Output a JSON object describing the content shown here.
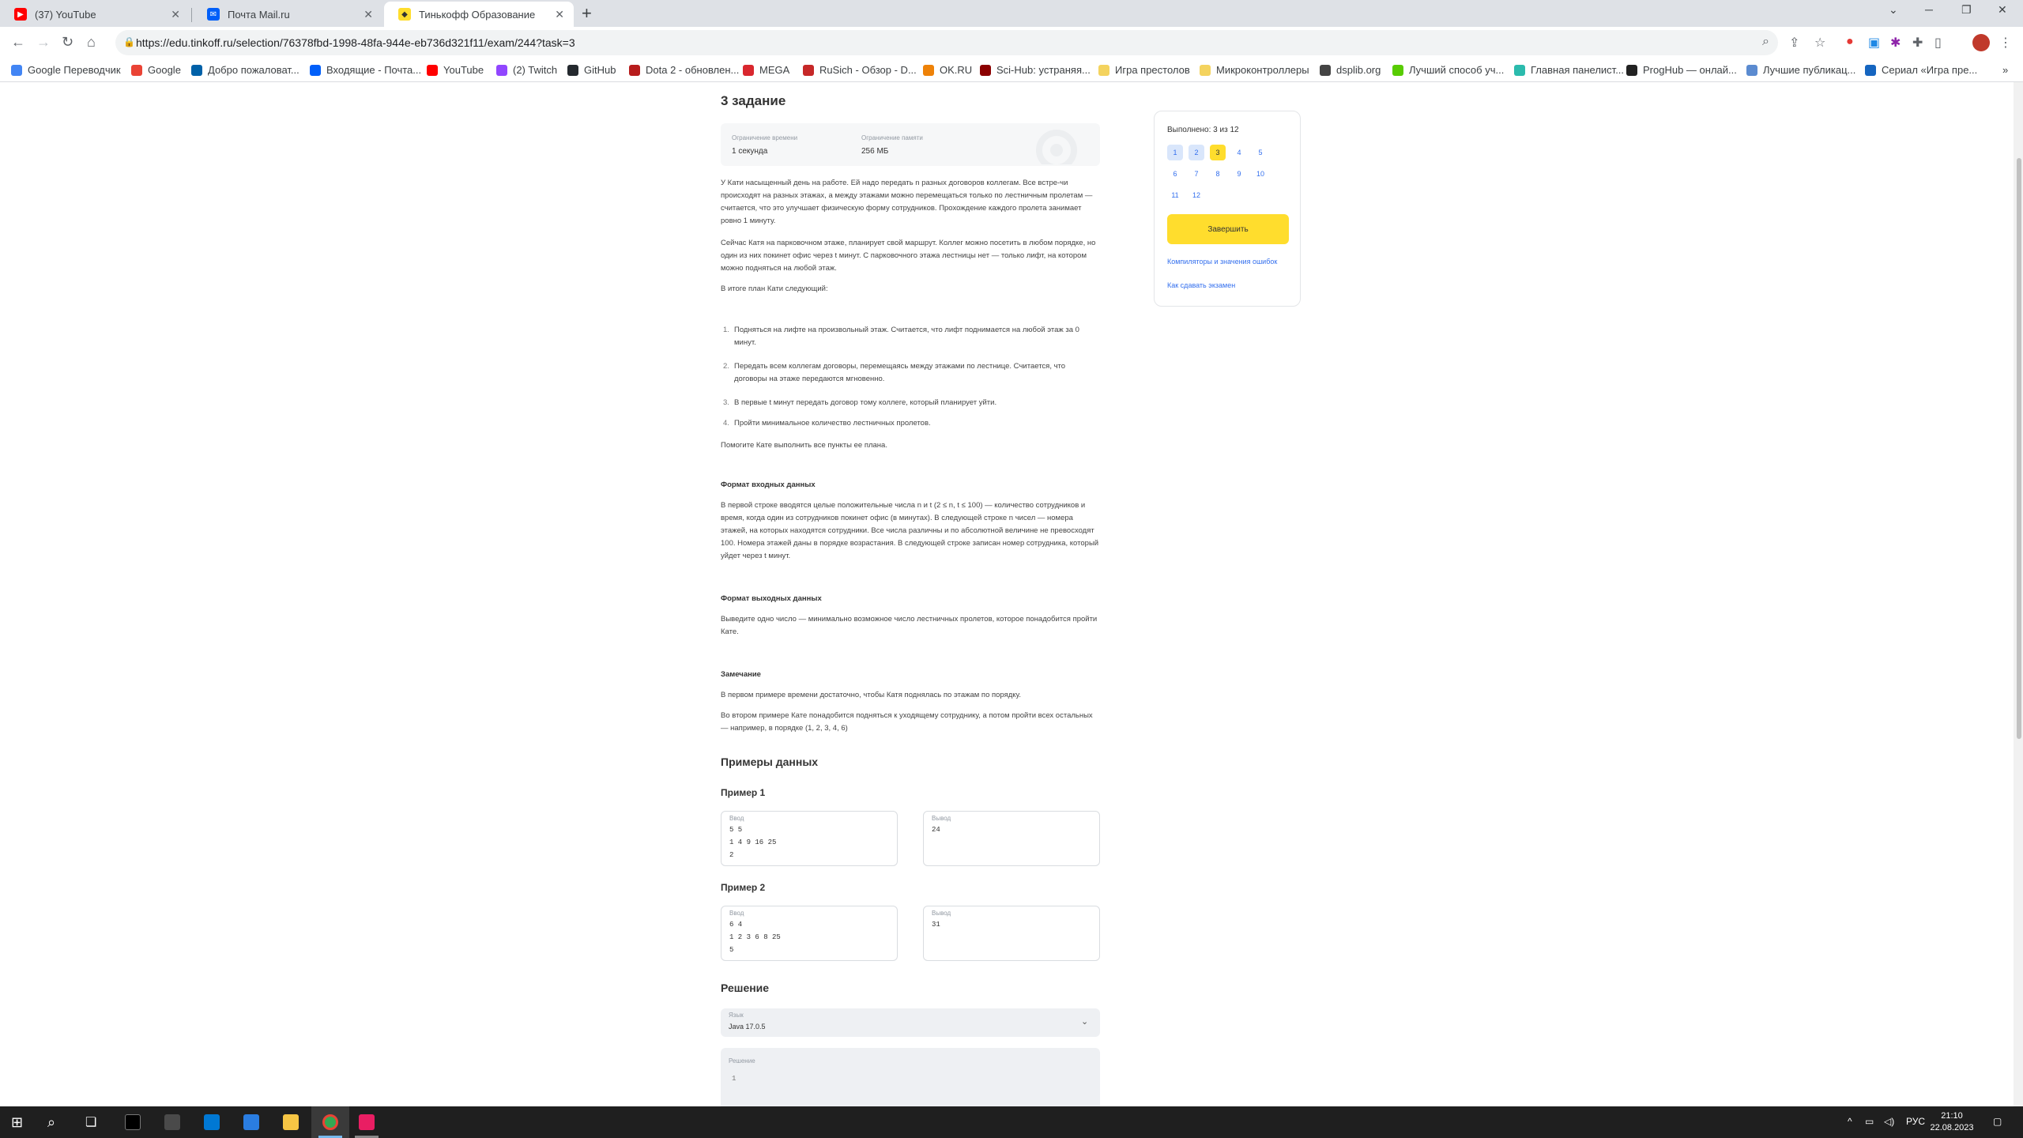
{
  "browser": {
    "tabs": [
      {
        "title": "(37) YouTube",
        "color": "#ff0000"
      },
      {
        "title": "Почта Mail.ru",
        "color": "#005ff9"
      },
      {
        "title": "Тинькофф Образование",
        "color": "#ffdd2d",
        "active": true
      }
    ],
    "url": "https://edu.tinkoff.ru/selection/76378fbd-1998-48fa-944e-eb736d321f11/exam/244?task=3",
    "bookmarks": [
      {
        "label": "Google Переводчик",
        "color": "#4285f4"
      },
      {
        "label": "Google",
        "color": "#ea4335"
      },
      {
        "label": "Добро пожаловат...",
        "color": "#0061a8"
      },
      {
        "label": "Входящие - Почта...",
        "color": "#005ff9"
      },
      {
        "label": "YouTube",
        "color": "#ff0000"
      },
      {
        "label": "(2) Twitch",
        "color": "#9146ff"
      },
      {
        "label": "GitHub",
        "color": "#24292e"
      },
      {
        "label": "Dota 2 - обновлен...",
        "color": "#b71c1c"
      },
      {
        "label": "MEGA",
        "color": "#d9272e"
      },
      {
        "label": "RuSich - Обзор - D...",
        "color": "#c62828"
      },
      {
        "label": "OK.RU",
        "color": "#ee8208"
      },
      {
        "label": "Sci-Hub: устраняя...",
        "color": "#8b0000"
      },
      {
        "label": "Игра престолов",
        "color": "#f4d35e"
      },
      {
        "label": "Микроконтроллеры",
        "color": "#f4d35e"
      },
      {
        "label": "dsplib.org",
        "color": "#444444"
      },
      {
        "label": "Лучший способ уч...",
        "color": "#58cc02"
      },
      {
        "label": "Главная панелист...",
        "color": "#2bbbad"
      },
      {
        "label": "ProgHub — онлай...",
        "color": "#222222"
      },
      {
        "label": "Лучшие публикац...",
        "color": "#5b8bd0"
      },
      {
        "label": "Сериал «Игра пре...",
        "color": "#1565c0"
      }
    ]
  },
  "task": {
    "title": "3 задание",
    "time_label": "Ограничение времени",
    "time_value": "1 секунда",
    "memory_label": "Ограничение памяти",
    "memory_value": "256 МБ",
    "statement": [
      "У Кати насыщенный день на работе. Ей надо передать n разных договоров коллегам. Все встре-чи происходят на разных этажах, а между этажами можно перемещаться только по лестничным пролетам — считается, что это улучшает физическую форму сотрудников. Прохождение каждого пролета занимает ровно 1 минуту.",
      "Сейчас Катя на парковочном этаже, планирует свой маршрут. Коллег можно посетить в любом порядке, но один из них покинет офис через t минут. С парковочного этажа лестницы нет — только лифт, на котором можно подняться на любой этаж.",
      "В итоге план Кати следующий:"
    ],
    "plan": [
      "Подняться на лифте на произвольный этаж. Считается, что лифт поднимается на любой этаж за 0 минут.",
      "Передать всем коллегам договоры, перемещаясь между этажами по лестнице. Считается, что договоры на этаже передаются мгновенно.",
      "В первые t минут передать договор тому коллеге, который планирует уйти.",
      "Пройти минимальное количество лестничных пролетов."
    ],
    "help": "Помогите Кате выполнить все пункты ее плана.",
    "input_title": "Формат входных данных",
    "input_text": "В первой строке вводятся целые положительные числа n и t (2 ≤ n, t ≤ 100) — количество сотрудников и время, когда один из сотрудников покинет офис (в минутах). В следующей строке n чисел — номера этажей, на которых находятся сотрудники. Все числа различны и по абсолютной величине не превосходят 100. Номера этажей даны в порядке возрастания. В следующей строке записан номер сотрудника, который уйдет через t минут.",
    "output_title": "Формат выходных данных",
    "output_text": "Выведите одно число — минимально возможное число лестничных пролетов, которое понадобится пройти Кате.",
    "note_title": "Замечание",
    "note_1": "В первом примере времени достаточно, чтобы Катя поднялась по этажам по порядку.",
    "note_2": "Во втором примере Кате понадобится подняться к уходящему сотруднику, а потом пройти всех остальных — например, в порядке (1, 2, 3, 4, 6)",
    "examples_title": "Примеры данных",
    "example1_title": "Пример 1",
    "example2_title": "Пример 2",
    "in_label": "Ввод",
    "out_label": "Вывод",
    "example1_in": [
      "5 5",
      "1 4 9 16 25",
      "2"
    ],
    "example1_out": "24",
    "example2_in": [
      "6 4",
      "1 2 3 6 8 25",
      "5"
    ],
    "example2_out": "31",
    "solution_title": "Решение",
    "lang_label": "Язык",
    "lang_value": "Java 17.0.5",
    "editor_label": "Решение",
    "editor_line": "1"
  },
  "panel": {
    "progress": "Выполнено: 3 из 12",
    "questions": [
      "1",
      "2",
      "3",
      "4",
      "5",
      "6",
      "7",
      "8",
      "9",
      "10",
      "11",
      "12"
    ],
    "finish": "Завершить",
    "link1": "Компиляторы и значения ошибок",
    "link2": "Как сдавать экзамен"
  },
  "taskbar": {
    "lang": "РУС",
    "time": "21:10",
    "date": "22.08.2023"
  }
}
